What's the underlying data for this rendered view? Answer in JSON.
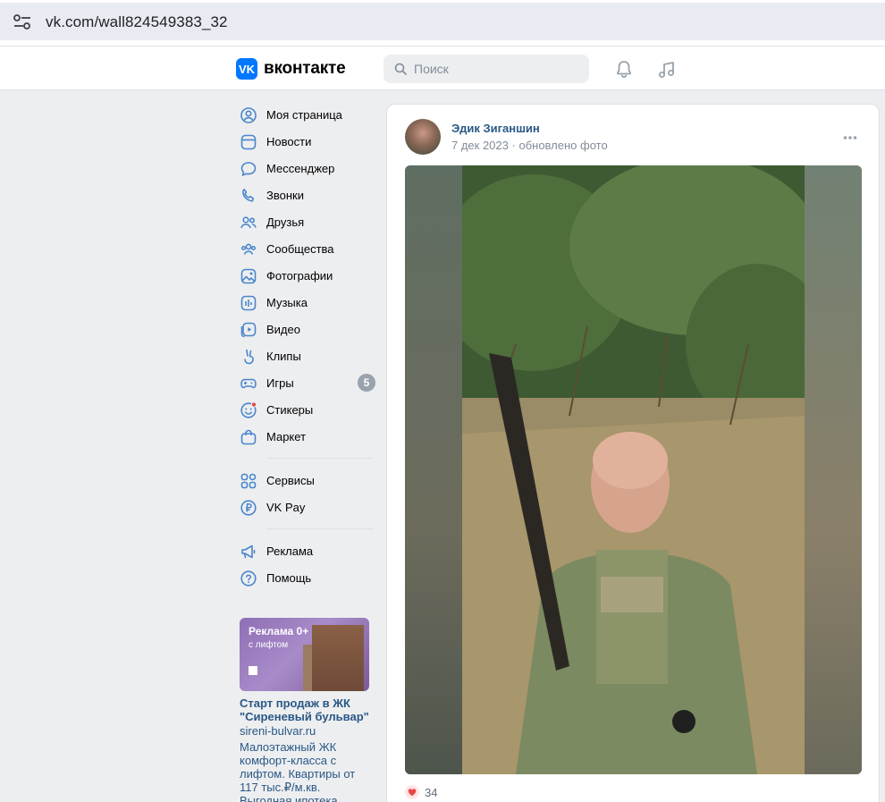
{
  "browser": {
    "url": "vk.com/wall824549383_32"
  },
  "header": {
    "logo_text": "вконтакте",
    "search_placeholder": "Поиск"
  },
  "sidebar": {
    "items": [
      {
        "label": "Моя страница",
        "icon": "user-circle-icon"
      },
      {
        "label": "Новости",
        "icon": "news-icon"
      },
      {
        "label": "Мессенджер",
        "icon": "message-icon"
      },
      {
        "label": "Звонки",
        "icon": "phone-icon"
      },
      {
        "label": "Друзья",
        "icon": "friends-icon"
      },
      {
        "label": "Сообщества",
        "icon": "communities-icon"
      },
      {
        "label": "Фотографии",
        "icon": "photo-icon"
      },
      {
        "label": "Музыка",
        "icon": "music-icon"
      },
      {
        "label": "Видео",
        "icon": "video-icon"
      },
      {
        "label": "Клипы",
        "icon": "clips-icon"
      },
      {
        "label": "Игры",
        "icon": "gamepad-icon",
        "badge": "5"
      },
      {
        "label": "Стикеры",
        "icon": "sticker-icon"
      },
      {
        "label": "Маркет",
        "icon": "market-icon"
      }
    ],
    "items2": [
      {
        "label": "Сервисы",
        "icon": "services-icon"
      },
      {
        "label": "VK Pay",
        "icon": "ruble-icon"
      }
    ],
    "items3": [
      {
        "label": "Реклама",
        "icon": "megaphone-icon"
      },
      {
        "label": "Помощь",
        "icon": "help-icon"
      }
    ]
  },
  "ad": {
    "image_label": "Реклама 0+",
    "image_sub": "с лифтом",
    "title": "Старт продаж в ЖК \"Сиреневый бульвар\"",
    "domain": "sireni-bulvar.ru",
    "text": "Малоэтажный ЖК комфорт-класса с лифтом. Квартиры от 117 тыс.₽/м.кв. Выгодная ипотека"
  },
  "post": {
    "author": "Эдик Зиганшин",
    "date": "7 дек 2023",
    "action": "обновлено фото",
    "likes": "34"
  },
  "colors": {
    "accent": "#0077ff",
    "link": "#2a5885",
    "muted": "#818c99",
    "like": "#e64646"
  }
}
